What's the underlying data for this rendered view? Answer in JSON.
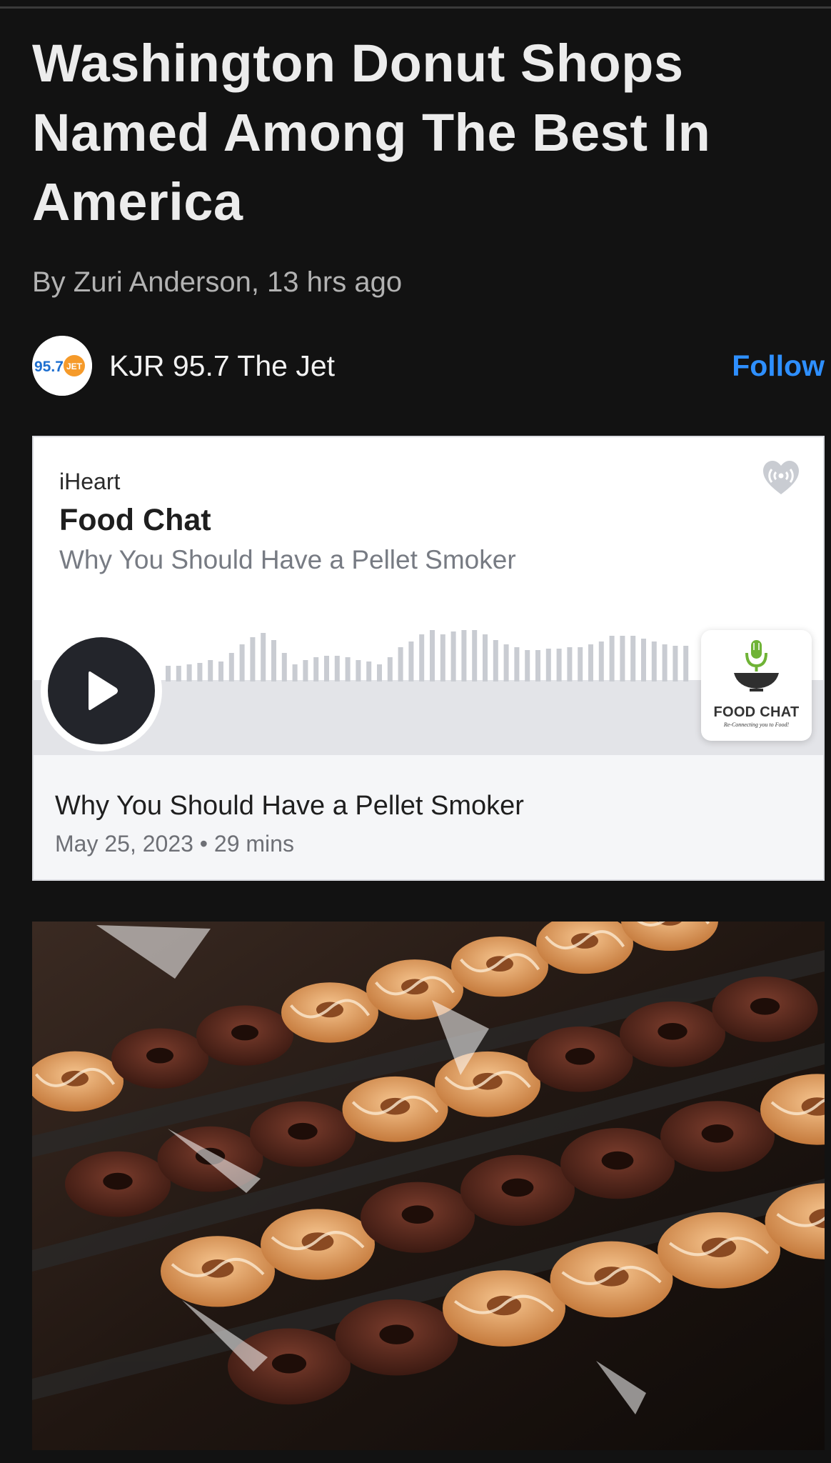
{
  "article": {
    "headline": "Washington Donut Shops Named Among The Best In America",
    "byline": "By Zuri Anderson, 13 hrs ago"
  },
  "publisher": {
    "name": "KJR 95.7 The Jet",
    "follow_label": "Follow",
    "logo_text": "95.7",
    "logo_badge": "JET",
    "accent_color": "#2e8fff"
  },
  "podcast": {
    "provider": "iHeart",
    "show": "Food Chat",
    "episode": "Why You Should Have a Pellet Smoker",
    "thumbnail_title": "FOOD CHAT",
    "thumbnail_tagline": "Re-Connecting you to Food!",
    "footer_title": "Why You Should Have a Pellet Smoker",
    "footer_meta": "May 25, 2023 • 29 mins",
    "icons": {
      "play": "play-icon",
      "brand": "iheart-icon"
    }
  }
}
